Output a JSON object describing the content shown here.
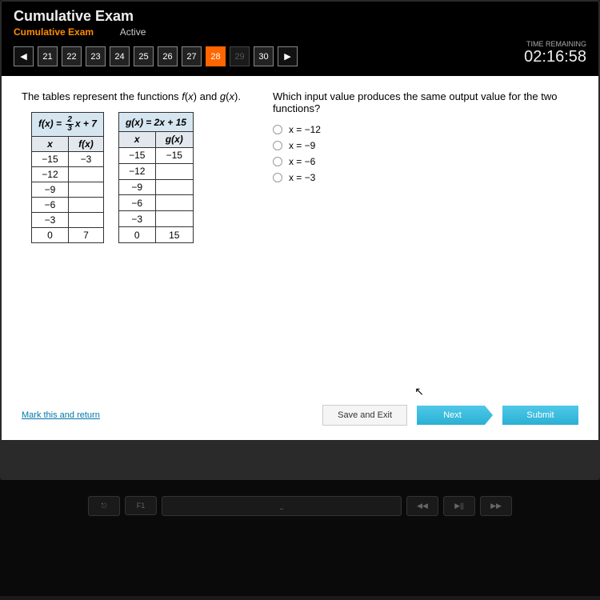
{
  "header": {
    "title": "Cumulative Exam",
    "subtitle_highlight": "Cumulative Exam",
    "subtitle_status": "Active"
  },
  "nav": {
    "items": [
      "21",
      "22",
      "23",
      "24",
      "25",
      "26",
      "27",
      "28",
      "29",
      "30"
    ],
    "current": "28",
    "disabled": "29",
    "prev": "◀",
    "next": "▶"
  },
  "timer": {
    "label": "TIME REMAINING",
    "value": "02:16:58"
  },
  "left": {
    "prompt": "The tables represent the functions f(x) and g(x).",
    "table_f": {
      "formula_prefix": "f(x) = ",
      "formula_frac_num": "2",
      "formula_frac_den": "3",
      "formula_suffix": "x + 7",
      "col1": "x",
      "col2": "f(x)",
      "rows": [
        [
          "−15",
          "−3"
        ],
        [
          "−12",
          ""
        ],
        [
          "−9",
          ""
        ],
        [
          "−6",
          ""
        ],
        [
          "−3",
          ""
        ],
        [
          "0",
          "7"
        ]
      ]
    },
    "table_g": {
      "formula": "g(x) = 2x + 15",
      "col1": "x",
      "col2": "g(x)",
      "rows": [
        [
          "−15",
          "−15"
        ],
        [
          "−12",
          ""
        ],
        [
          "−9",
          ""
        ],
        [
          "−6",
          ""
        ],
        [
          "−3",
          ""
        ],
        [
          "0",
          "15"
        ]
      ]
    }
  },
  "right": {
    "question": "Which input value produces the same output value for the two functions?",
    "options": [
      "x = −12",
      "x = −9",
      "x = −6",
      "x = −3"
    ]
  },
  "footer": {
    "mark": "Mark this and return",
    "save": "Save and Exit",
    "next": "Next",
    "submit": "Submit"
  },
  "keys": [
    "⎋",
    "F1",
    "⎵",
    "◀◀",
    "▶||",
    "▶▶"
  ]
}
